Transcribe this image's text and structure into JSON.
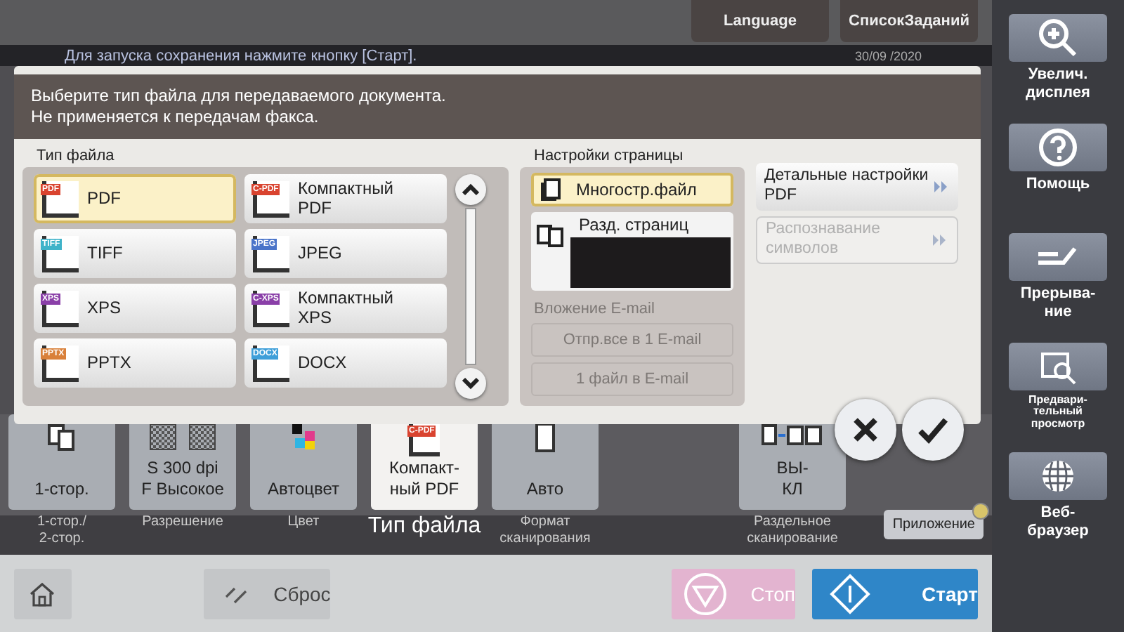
{
  "top_bar": {
    "buttons": [
      "Language",
      "СписокЗаданий"
    ]
  },
  "status": {
    "message": "Для запуска сохранения нажмите кнопку [Старт].",
    "date": "30/09 /2020"
  },
  "dialog": {
    "instruction": [
      "Выберите тип файла для передаваемого документа.",
      "Не применяется к передачам факса."
    ],
    "file_type": {
      "title": "Тип файла",
      "options": [
        {
          "label": "PDF",
          "badge": "PDF",
          "color": "#d9432f",
          "selected": true
        },
        {
          "label": "Компактный PDF",
          "badge": "C-PDF",
          "color": "#d9432f",
          "selected": false
        },
        {
          "label": "TIFF",
          "badge": "TIFF",
          "color": "#3fb3c9",
          "selected": false
        },
        {
          "label": "JPEG",
          "badge": "JPEG",
          "color": "#4a74c9",
          "selected": false
        },
        {
          "label": "XPS",
          "badge": "XPS",
          "color": "#8a3fa8",
          "selected": false
        },
        {
          "label": "Компактный XPS",
          "badge": "C-XPS",
          "color": "#8a3fa8",
          "selected": false
        },
        {
          "label": "PPTX",
          "badge": "PPTX",
          "color": "#d9803a",
          "selected": false
        },
        {
          "label": "DOCX",
          "badge": "DOCX",
          "color": "#3f9fd9",
          "selected": false
        }
      ]
    },
    "page_settings": {
      "title": "Настройки страницы",
      "options": [
        {
          "label": "Многостр.файл",
          "kind": "multi",
          "selected": true
        },
        {
          "label": "Разд. страниц",
          "kind": "split",
          "selected": false
        }
      ]
    },
    "email": {
      "title": "Вложение E-mail",
      "disabled": true,
      "options": [
        "Отпр.все в 1 E-mail",
        "1 файл в E-mail"
      ]
    },
    "side_buttons": [
      {
        "label": "Детальные настройки PDF",
        "disabled": false
      },
      {
        "label": "Распознавание символов",
        "disabled": true
      }
    ]
  },
  "tiles": [
    {
      "kind": "duplex",
      "value": [
        "1-стор."
      ],
      "caption": [
        "1-стор./",
        "2-стор."
      ],
      "selected": false
    },
    {
      "kind": "resolution",
      "value": [
        "S 300 dpi",
        "F Высокое"
      ],
      "caption": [
        "Разрешение"
      ],
      "selected": false
    },
    {
      "kind": "color",
      "value": [
        "Автоцвет"
      ],
      "caption": [
        "Цвет"
      ],
      "selected": false
    },
    {
      "kind": "filetype",
      "value": [
        "Компакт-",
        "ный PDF"
      ],
      "badge": "C-PDF",
      "caption": [
        "Тип файла"
      ],
      "selected": true
    },
    {
      "kind": "size",
      "value": [
        "Авто"
      ],
      "caption": [
        "Формат",
        "сканирования"
      ],
      "selected": false
    },
    {
      "kind": "separate",
      "value": [
        "ВЫ-",
        "КЛ"
      ],
      "caption": [
        "Раздельное",
        "сканирование"
      ],
      "selected": false
    }
  ],
  "app_button": "Приложение",
  "sidebar": [
    {
      "kind": "zoom",
      "label": [
        "Увелич.",
        "дисплея"
      ]
    },
    {
      "kind": "help",
      "label": [
        "Помощь"
      ]
    },
    {
      "kind": "interrupt",
      "label": [
        "Прерыва-",
        "ние"
      ]
    },
    {
      "kind": "preview",
      "label": [
        "Предвари-",
        "тельный",
        "просмотр"
      ]
    },
    {
      "kind": "web",
      "label": [
        "Веб-",
        "браузер"
      ]
    }
  ],
  "bottom": {
    "reset": "Сброс",
    "stop": "Стоп",
    "start": "Старт"
  }
}
